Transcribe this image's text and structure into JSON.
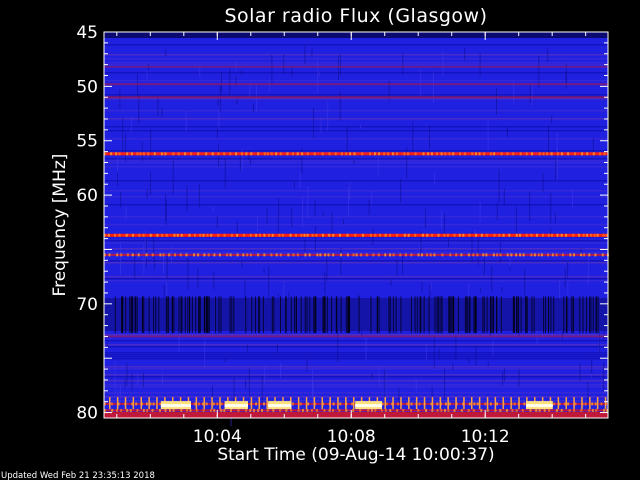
{
  "chart_data": {
    "type": "heatmap",
    "title": "Solar radio Flux (Glasgow)",
    "xlabel": "Start Time (09-Aug-14 10:00:37)",
    "ylabel": "Frequency [MHz]",
    "ylim": [
      45,
      80.5
    ],
    "ytick_values": [
      45,
      50,
      55,
      60,
      65,
      70,
      75,
      80
    ],
    "ytick_labels": [
      "45",
      "50",
      "55",
      "60",
      "",
      "70",
      "",
      "80"
    ],
    "xlim_minutes": [
      0,
      15.05
    ],
    "xticks": [
      {
        "minute": 3.383,
        "label": "10:04"
      },
      {
        "minute": 7.383,
        "label": "10:08"
      },
      {
        "minute": 11.383,
        "label": "10:12"
      }
    ],
    "background_color": "#2020e0",
    "bands": [
      {
        "freq": 48.2,
        "intensity": 0.35
      },
      {
        "freq": 49.8,
        "intensity": 0.55
      },
      {
        "freq": 51.0,
        "intensity": 0.6
      },
      {
        "freq": 56.2,
        "intensity": 0.95
      },
      {
        "freq": 63.7,
        "intensity": 1.0
      },
      {
        "freq": 65.5,
        "intensity": 0.7
      },
      {
        "freq": 73.0,
        "intensity": 0.45
      },
      {
        "freq": 79.2,
        "intensity": 0.75
      },
      {
        "freq": 79.8,
        "intensity": 0.85
      }
    ],
    "bursts_80MHz": [
      {
        "start_minute": 1.7,
        "end_minute": 2.6
      },
      {
        "start_minute": 3.6,
        "end_minute": 4.3
      },
      {
        "start_minute": 4.9,
        "end_minute": 5.6
      },
      {
        "start_minute": 7.5,
        "end_minute": 8.3
      },
      {
        "start_minute": 12.6,
        "end_minute": 13.4
      }
    ],
    "dark_region": {
      "freq_start": 69.5,
      "freq_end": 72.5
    }
  },
  "footer": {
    "updated": "Updated Wed Feb 21 23:35:13 2018"
  }
}
